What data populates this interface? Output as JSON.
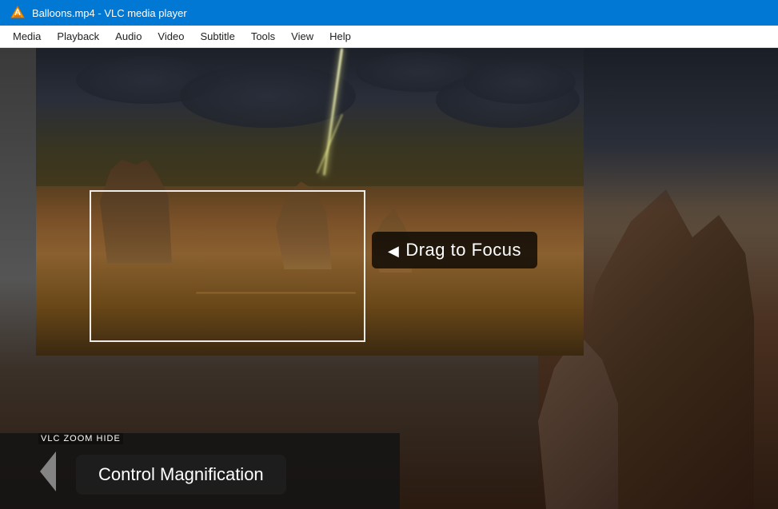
{
  "titlebar": {
    "title": "Balloons.mp4 - VLC media player",
    "icon": "vlc-cone-icon"
  },
  "menubar": {
    "items": [
      {
        "id": "media",
        "label": "Media"
      },
      {
        "id": "playback",
        "label": "Playback"
      },
      {
        "id": "audio",
        "label": "Audio"
      },
      {
        "id": "video",
        "label": "Video"
      },
      {
        "id": "subtitle",
        "label": "Subtitle"
      },
      {
        "id": "tools",
        "label": "Tools"
      },
      {
        "id": "view",
        "label": "View"
      },
      {
        "id": "help",
        "label": "Help"
      }
    ]
  },
  "overlays": {
    "drag_to_focus": "Drag to Focus",
    "control_magnification": "Control Magnification",
    "zoom_hide_label": "VLC ZOOM HIDE"
  }
}
